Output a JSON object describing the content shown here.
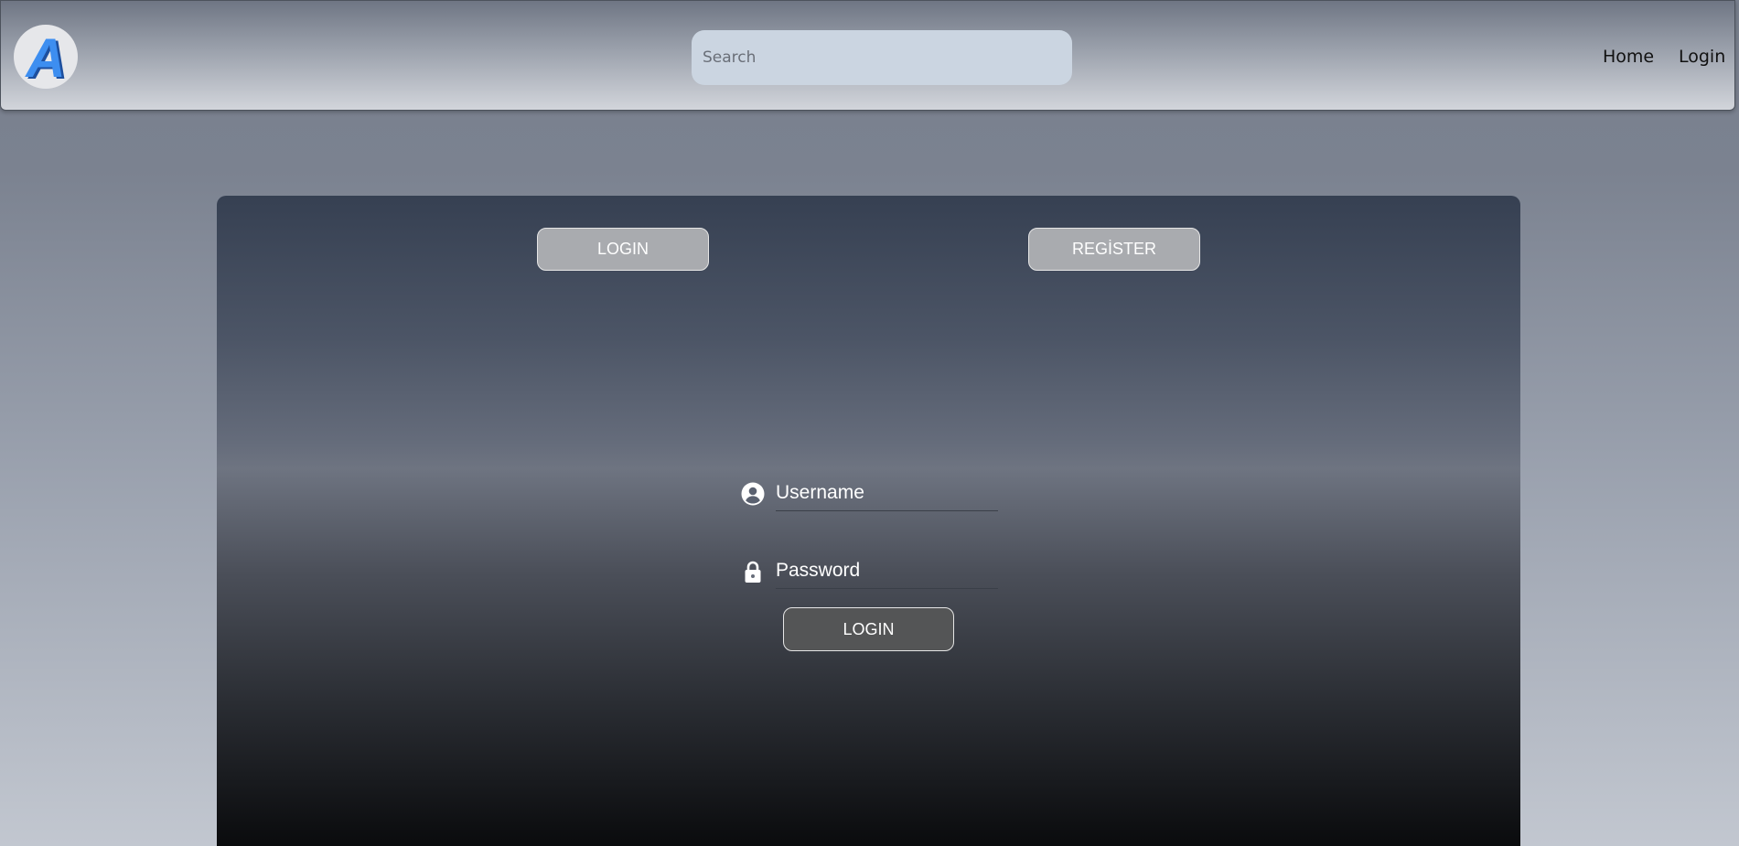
{
  "header": {
    "logo_letter": "A",
    "search": {
      "placeholder": "Search",
      "value": ""
    },
    "nav": {
      "home": "Home",
      "login": "Login"
    }
  },
  "tabs": {
    "login": "LOGIN",
    "register": "REGİSTER"
  },
  "form": {
    "username": {
      "placeholder": "Username",
      "icon": "user-circle-icon"
    },
    "password": {
      "placeholder": "Password",
      "icon": "lock-icon"
    },
    "submit_label": "LOGIN"
  },
  "colors": {
    "logo_blue": "#3d8ef0",
    "search_bg": "#cbd5e1",
    "tab_bg": "#a9abaf",
    "submit_bg": "#545556"
  }
}
